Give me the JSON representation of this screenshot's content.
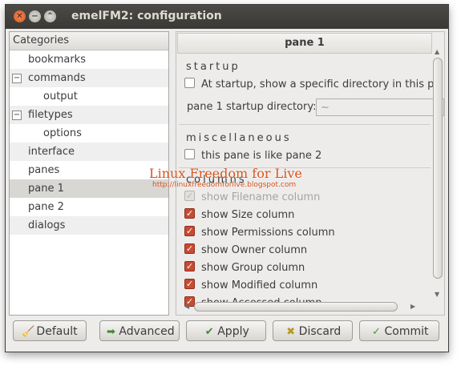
{
  "window": {
    "title": "emelFM2: configuration"
  },
  "sidebar": {
    "header": "Categories",
    "items": [
      {
        "label": "bookmarks"
      },
      {
        "label": "commands",
        "expander": "−"
      },
      {
        "label": "output"
      },
      {
        "label": "filetypes",
        "expander": "−"
      },
      {
        "label": "options"
      },
      {
        "label": "interface"
      },
      {
        "label": "panes"
      },
      {
        "label": "pane 1",
        "selected": true
      },
      {
        "label": "pane 2"
      },
      {
        "label": "dialogs"
      }
    ]
  },
  "panel": {
    "title": "pane 1",
    "startup": {
      "heading": "startup",
      "show_dir_label": "At startup, show a specific directory in this pa",
      "dir_label": "pane 1 startup directory:",
      "dir_value": "~"
    },
    "misc": {
      "heading": "miscellaneous",
      "like_pane2_label": "this pane is like pane 2"
    },
    "columns": {
      "heading": "columns",
      "items": [
        {
          "label": "show Filename column",
          "checked": true,
          "disabled": true
        },
        {
          "label": "show Size column",
          "checked": true
        },
        {
          "label": "show Permissions column",
          "checked": true
        },
        {
          "label": "show Owner column",
          "checked": true
        },
        {
          "label": "show Group column",
          "checked": true
        },
        {
          "label": "show Modified column",
          "checked": true
        },
        {
          "label": "show Accessed column",
          "checked": true
        }
      ]
    }
  },
  "buttons": {
    "default": "Default",
    "advanced": "Advanced",
    "apply": "Apply",
    "discard": "Discard",
    "commit": "Commit"
  },
  "watermark": {
    "title": "Linux Freedom for Live",
    "url": "http://linuxfreedomforlive.blogspot.com"
  }
}
